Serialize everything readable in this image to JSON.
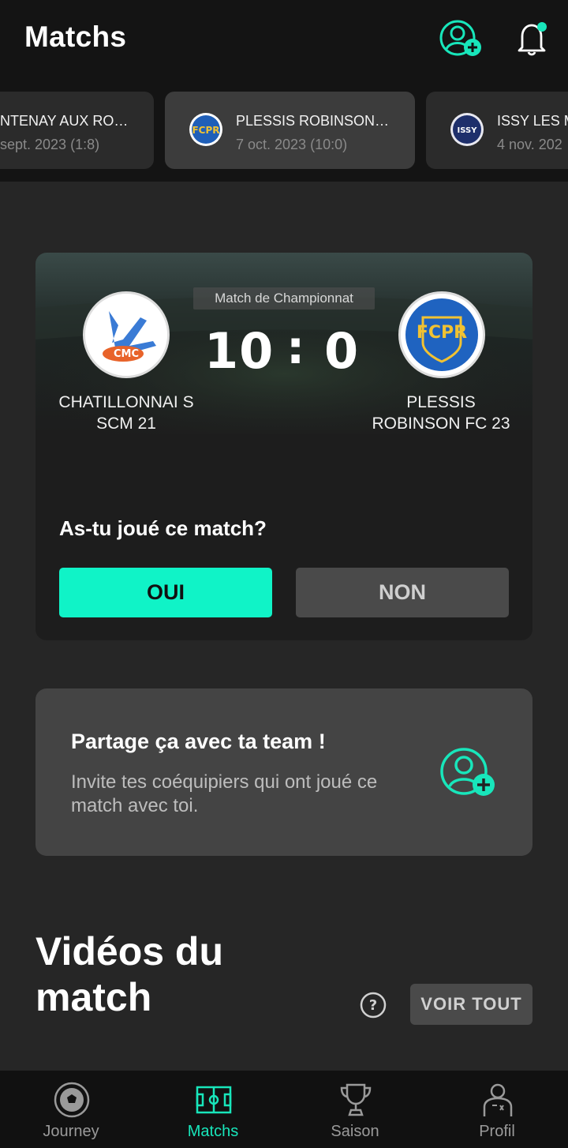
{
  "header": {
    "title": "Matchs"
  },
  "match_list": [
    {
      "name": "NTENAY AUX RO…",
      "date": "sept. 2023 (1:8)"
    },
    {
      "name": "PLESSIS ROBINSON…",
      "date": "7 oct. 2023 (10:0)",
      "logo_text": "FCPR"
    },
    {
      "name": "ISSY LES M",
      "date": "4 nov. 202",
      "logo_text": "ISSY"
    }
  ],
  "match": {
    "competition": "Match de Championnat",
    "home_score": "10",
    "separator": ":",
    "away_score": "0",
    "home_team": "CHATILLONNAI S SCM 21",
    "away_team": "PLESSIS ROBINSON FC 23",
    "home_logo_text": "CMC",
    "away_logo_text": "FCPR",
    "question": "As-tu joué ce match?",
    "yes_label": "OUI",
    "no_label": "NON"
  },
  "share": {
    "title": "Partage ça avec ta team !",
    "description": "Invite tes coéquipiers qui ont joué ce match avec toi."
  },
  "videos": {
    "title": "Vidéos du match",
    "see_all_label": "VOIR TOUT"
  },
  "nav": [
    {
      "label": "Journey",
      "icon": "soccer-ball-icon"
    },
    {
      "label": "Matchs",
      "icon": "pitch-icon",
      "active": true
    },
    {
      "label": "Saison",
      "icon": "trophy-icon"
    },
    {
      "label": "Profil",
      "icon": "player-icon"
    }
  ],
  "colors": {
    "accent": "#10f3c7",
    "background": "#262626",
    "header": "#141414"
  }
}
